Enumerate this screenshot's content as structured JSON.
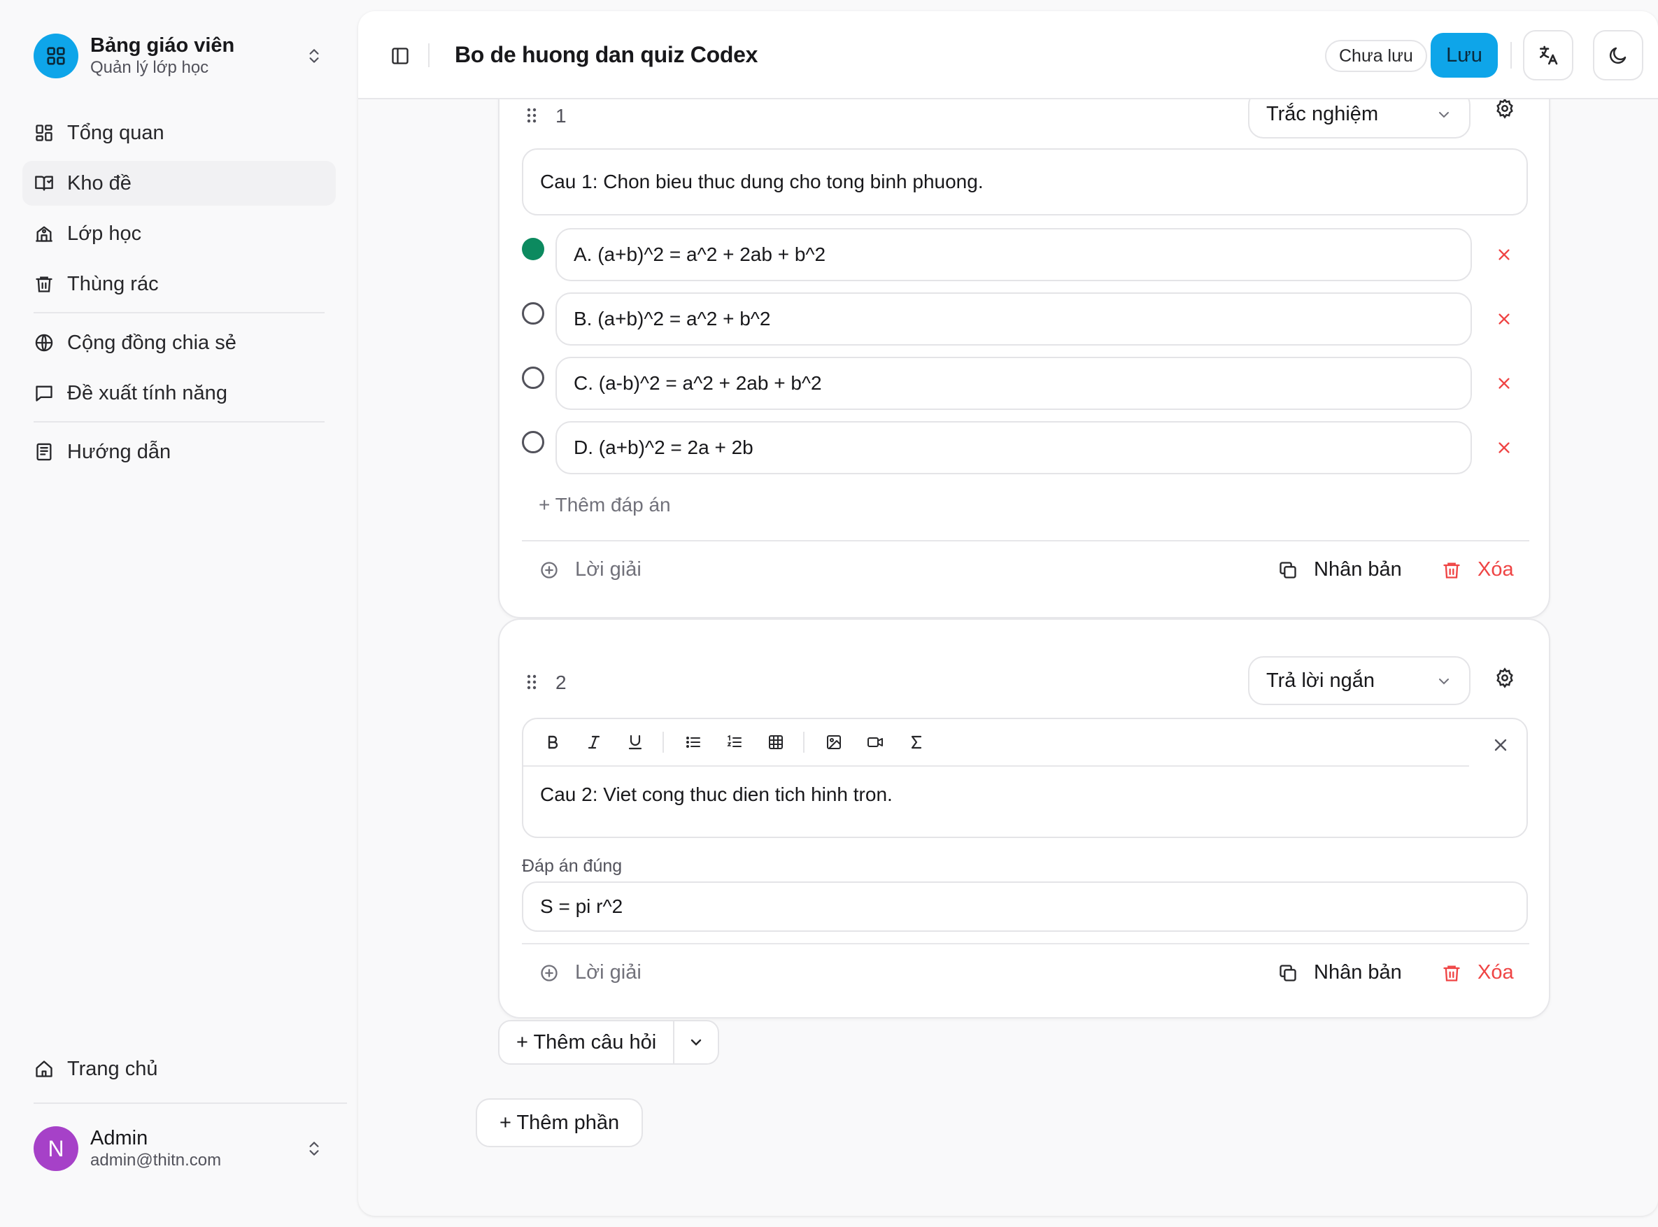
{
  "sidebar": {
    "brand": {
      "title": "Bảng giáo viên",
      "subtitle": "Quản lý lớp học",
      "icon": "dashboard-grid-icon"
    },
    "nav_primary": [
      {
        "label": "Tổng quan",
        "icon": "layout-grid-icon"
      },
      {
        "label": "Kho đề",
        "icon": "book-icon",
        "active": true
      },
      {
        "label": "Lớp học",
        "icon": "school-icon"
      },
      {
        "label": "Thùng rác",
        "icon": "trash-icon"
      }
    ],
    "nav_secondary": [
      {
        "label": "Cộng đồng chia sẻ",
        "icon": "globe-icon"
      },
      {
        "label": "Đề xuất tính năng",
        "icon": "message-square-icon"
      }
    ],
    "nav_tertiary": [
      {
        "label": "Hướng dẫn",
        "icon": "notebook-icon"
      }
    ],
    "home": {
      "label": "Trang chủ",
      "icon": "home-icon"
    },
    "user": {
      "initial": "N",
      "name": "Admin",
      "email": "admin@thitn.com",
      "avatar_color": "#a641c8"
    }
  },
  "topbar": {
    "title": "Bo de huong dan quiz Codex",
    "status": "Chưa lưu",
    "save_label": "Lưu",
    "accent": "#0ea5e9"
  },
  "questions": [
    {
      "number": "1",
      "type": "Trắc nghiệm",
      "text": "Cau 1: Chon bieu thuc dung cho tong binh phuong.",
      "answers": [
        {
          "text": "A. (a+b)^2 = a^2 + 2ab + b^2",
          "correct": true
        },
        {
          "text": "B. (a+b)^2 = a^2 + b^2",
          "correct": false
        },
        {
          "text": "C. (a-b)^2 = a^2 + 2ab + b^2",
          "correct": false
        },
        {
          "text": "D. (a+b)^2 = 2a + 2b",
          "correct": false
        }
      ],
      "add_answer": "+ Thêm đáp án",
      "footer": {
        "solution": "Lời giải",
        "duplicate": "Nhân bản",
        "delete": "Xóa"
      }
    },
    {
      "number": "2",
      "type": "Trả lời ngắn",
      "text": "Cau 2: Viet cong thuc dien tich hinh tron.",
      "correct_label": "Đáp án đúng",
      "correct_value": "S = pi r^2",
      "toolbar": [
        "bold-icon",
        "italic-icon",
        "underline-icon",
        "bullet-list-icon",
        "numbered-list-icon",
        "table-icon",
        "image-icon",
        "video-icon",
        "sigma-icon"
      ],
      "footer": {
        "solution": "Lời giải",
        "duplicate": "Nhân bản",
        "delete": "Xóa"
      }
    }
  ],
  "actions": {
    "add_question": "+ Thêm câu hỏi",
    "add_section": "+ Thêm phần"
  },
  "colors": {
    "correct": "#0c8a5f",
    "danger": "#ef4444"
  }
}
